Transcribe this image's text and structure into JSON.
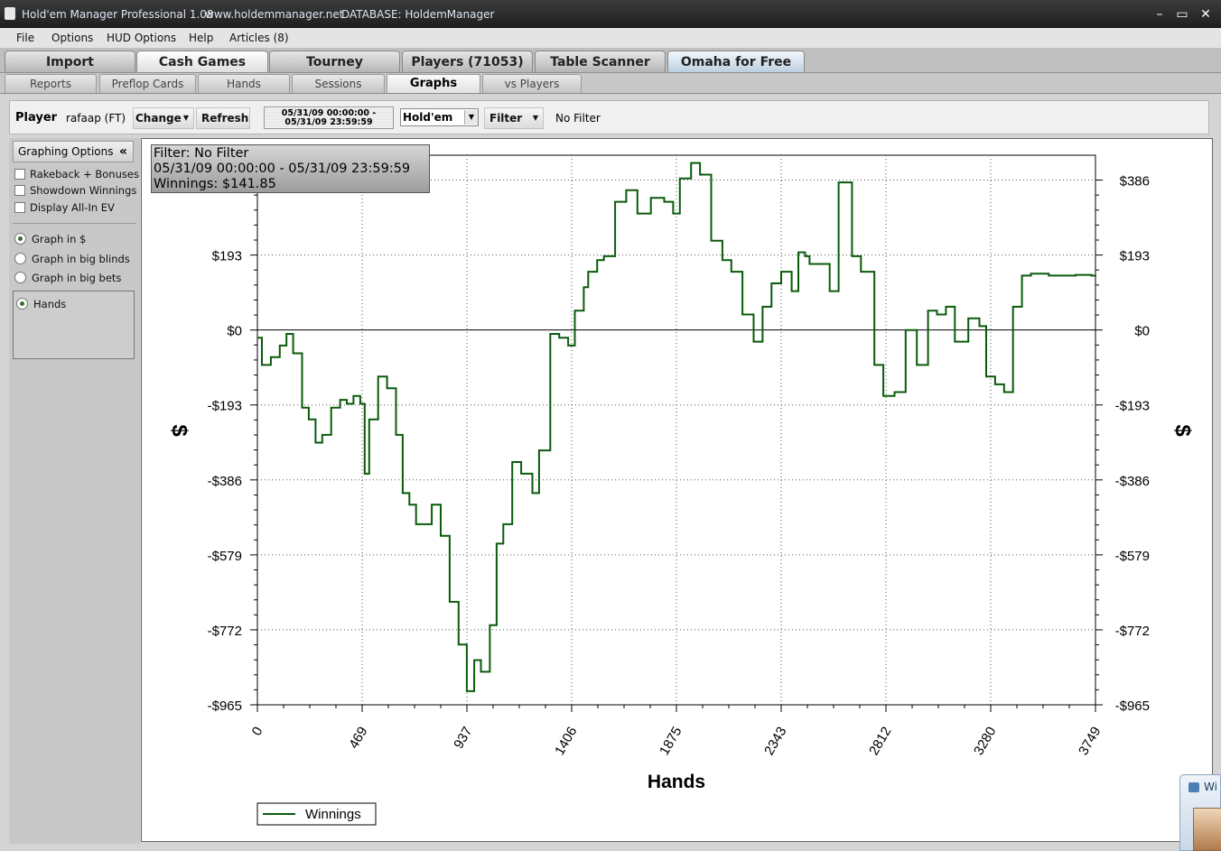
{
  "window": {
    "title": "Hold'em Manager Professional 1.08",
    "website": "www.holdemmanager.net",
    "database": "DATABASE: HoldemManager",
    "minimize": "–",
    "maximize": "▭",
    "close": "✕"
  },
  "menu": [
    "File",
    "Options",
    "HUD Options",
    "Help",
    "Articles (8)"
  ],
  "main_tabs": [
    "Import",
    "Cash Games",
    "Tourney",
    "Players (71053)",
    "Table Scanner",
    "Omaha for Free"
  ],
  "sub_tabs": [
    "Reports",
    "Preflop Cards",
    "Hands",
    "Sessions",
    "Graphs",
    "vs Players"
  ],
  "toolbar": {
    "player_label": "Player",
    "player_name": "rafaap (FT)",
    "change": "Change",
    "refresh": "Refresh",
    "date_start": "05/31/09 00:00:00 -",
    "date_end": "05/31/09 23:59:59",
    "game_select": "Hold'em",
    "filter": "Filter",
    "filter_status": "No Filter"
  },
  "sidebar": {
    "title": "Graphing Options",
    "collapse": "«",
    "checkboxes": [
      "Rakeback + Bonuses",
      "Showdown Winnings",
      "Display All-In EV"
    ],
    "radios": [
      "Graph in $",
      "Graph in big blinds",
      "Graph in big bets"
    ],
    "axis_options": [
      "Hands"
    ]
  },
  "overlay": {
    "filter": "Filter: No Filter",
    "date_range": "05/31/09 00:00:00 - 05/31/09 23:59:59",
    "winnings": "Winnings: $141.85"
  },
  "popup": {
    "text": "Wi"
  },
  "chart_data": {
    "type": "line",
    "xlabel": "Hands",
    "ylabel": "$",
    "xlim": [
      0,
      3749
    ],
    "ylim": [
      -965,
      450
    ],
    "x_ticks": [
      "0",
      "469",
      "937",
      "1406",
      "1875",
      "2343",
      "2812",
      "3280",
      "3749"
    ],
    "y_ticks": [
      "$386",
      "$193",
      "$0",
      "-$193",
      "-$386",
      "-$579",
      "-$772",
      "-$965"
    ],
    "y_tick_values": [
      386,
      193,
      0,
      -193,
      -386,
      -579,
      -772,
      -965
    ],
    "grid": true,
    "legend": "bottom-left",
    "series": [
      {
        "name": "Winnings",
        "color": "#0a5a0a",
        "x": [
          0,
          20,
          60,
          100,
          130,
          160,
          200,
          230,
          260,
          290,
          330,
          370,
          400,
          430,
          460,
          480,
          500,
          540,
          580,
          620,
          650,
          680,
          710,
          740,
          780,
          820,
          860,
          900,
          937,
          970,
          1000,
          1040,
          1070,
          1100,
          1140,
          1180,
          1230,
          1260,
          1310,
          1350,
          1390,
          1420,
          1460,
          1480,
          1520,
          1550,
          1600,
          1650,
          1700,
          1760,
          1820,
          1860,
          1890,
          1940,
          1980,
          2030,
          2080,
          2120,
          2170,
          2220,
          2260,
          2300,
          2343,
          2390,
          2420,
          2450,
          2470,
          2500,
          2560,
          2600,
          2660,
          2700,
          2760,
          2800,
          2850,
          2900,
          2950,
          3000,
          3040,
          3080,
          3120,
          3180,
          3230,
          3260,
          3300,
          3340,
          3380,
          3420,
          3460,
          3500,
          3540,
          3580,
          3620,
          3660,
          3690,
          3710,
          3730,
          3749
        ],
        "y": [
          -20,
          -90,
          -70,
          -40,
          -10,
          -60,
          -200,
          -230,
          -290,
          -270,
          -200,
          -180,
          -190,
          -170,
          -190,
          -370,
          -230,
          -120,
          -150,
          -270,
          -420,
          -450,
          -500,
          -500,
          -450,
          -530,
          -700,
          -810,
          -930,
          -850,
          -880,
          -760,
          -550,
          -500,
          -340,
          -370,
          -420,
          -310,
          -10,
          -20,
          -40,
          50,
          110,
          150,
          180,
          190,
          330,
          360,
          300,
          340,
          330,
          300,
          390,
          430,
          400,
          230,
          180,
          150,
          40,
          -30,
          60,
          120,
          150,
          100,
          200,
          190,
          170,
          170,
          100,
          380,
          190,
          150,
          -90,
          -170,
          -160,
          0,
          -90,
          50,
          40,
          60,
          -30,
          30,
          10,
          -120,
          -140,
          -160,
          60,
          140,
          145,
          145,
          140,
          140,
          140,
          142,
          142,
          142,
          140,
          141.85
        ]
      }
    ]
  }
}
